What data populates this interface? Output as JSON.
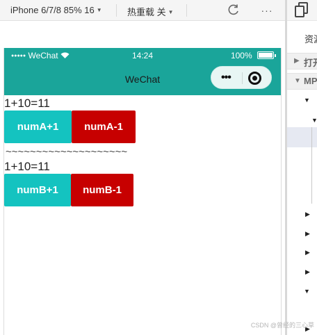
{
  "toolbar": {
    "device_label": "iPhone 6/7/8 85% 16",
    "hot_reload_label": "热重载 关",
    "refresh_icon": "refresh-icon",
    "more_label": "···"
  },
  "statusbar": {
    "signal": "●●●●●",
    "carrier": "WeChat",
    "wifi": "wifi-icon",
    "time": "14:24",
    "battery": "100%",
    "battery_fill": 1.0
  },
  "navbar": {
    "title": "WeChat",
    "capsule_more": "•••",
    "capsule_close_icon": "target-icon"
  },
  "content": {
    "expr_a": "1+10=11",
    "btn_a_plus": "numA+1",
    "btn_a_minus": "numA-1",
    "separator": "~~~~~~~~~~~~~~~~~~~~",
    "expr_b": "1+10=11",
    "btn_b_plus": "numB+1",
    "btn_b_minus": "numB-1"
  },
  "panel": {
    "resource_label": "资源",
    "section_open": "打开",
    "section_mp": "MP",
    "copy_icon": "copy-icon"
  },
  "colors": {
    "navbar": "#1aa59a",
    "btn_teal": "#14c3c0",
    "btn_red": "#c70000"
  },
  "watermark": "CSDN @曾经的三心草"
}
